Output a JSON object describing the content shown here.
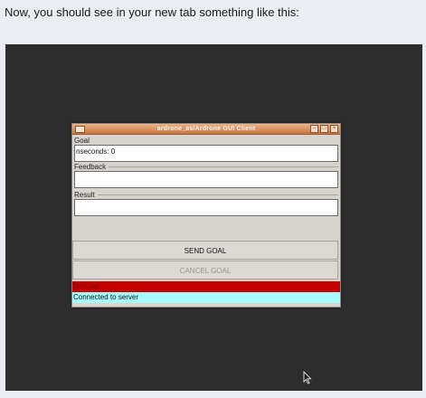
{
  "intro_text": "Now, you should see in your new tab something like this:",
  "window": {
    "title": "ardrone_as/Ardrone GUI Client",
    "goal_label": "Goal",
    "goal_value": "nseconds: 0",
    "feedback_label": "Feedback",
    "feedback_value": "",
    "result_label": "Result",
    "result_value": "",
    "send_goal_label": "SEND GOAL",
    "cancel_goal_label": "CANCEL GOAL",
    "goal_status": "No Goal",
    "server_status": "Connected to server"
  },
  "colors": {
    "titlebar": "#d08a57",
    "goal_status_bg": "#c40000",
    "server_status_bg": "#a6fbff",
    "desktop_bg": "#2d2d2d"
  },
  "icons": {
    "window_menu": "window-menu-icon",
    "minimize": "minimize-icon",
    "maximize": "maximize-icon",
    "close": "close-icon",
    "cursor": "mouse-cursor-icon"
  }
}
